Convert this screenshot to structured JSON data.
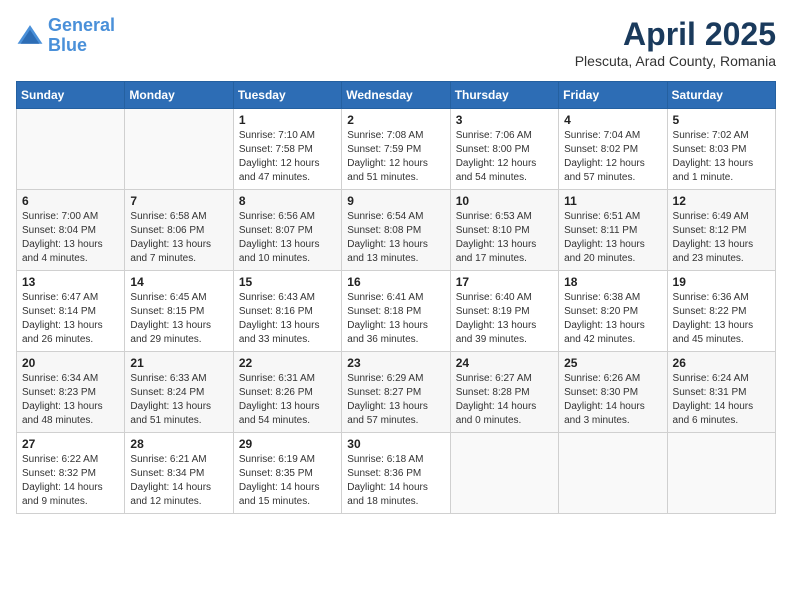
{
  "header": {
    "logo_line1": "General",
    "logo_line2": "Blue",
    "month": "April 2025",
    "location": "Plescuta, Arad County, Romania"
  },
  "weekdays": [
    "Sunday",
    "Monday",
    "Tuesday",
    "Wednesday",
    "Thursday",
    "Friday",
    "Saturday"
  ],
  "weeks": [
    [
      {
        "day": "",
        "info": ""
      },
      {
        "day": "",
        "info": ""
      },
      {
        "day": "1",
        "info": "Sunrise: 7:10 AM\nSunset: 7:58 PM\nDaylight: 12 hours and 47 minutes."
      },
      {
        "day": "2",
        "info": "Sunrise: 7:08 AM\nSunset: 7:59 PM\nDaylight: 12 hours and 51 minutes."
      },
      {
        "day": "3",
        "info": "Sunrise: 7:06 AM\nSunset: 8:00 PM\nDaylight: 12 hours and 54 minutes."
      },
      {
        "day": "4",
        "info": "Sunrise: 7:04 AM\nSunset: 8:02 PM\nDaylight: 12 hours and 57 minutes."
      },
      {
        "day": "5",
        "info": "Sunrise: 7:02 AM\nSunset: 8:03 PM\nDaylight: 13 hours and 1 minute."
      }
    ],
    [
      {
        "day": "6",
        "info": "Sunrise: 7:00 AM\nSunset: 8:04 PM\nDaylight: 13 hours and 4 minutes."
      },
      {
        "day": "7",
        "info": "Sunrise: 6:58 AM\nSunset: 8:06 PM\nDaylight: 13 hours and 7 minutes."
      },
      {
        "day": "8",
        "info": "Sunrise: 6:56 AM\nSunset: 8:07 PM\nDaylight: 13 hours and 10 minutes."
      },
      {
        "day": "9",
        "info": "Sunrise: 6:54 AM\nSunset: 8:08 PM\nDaylight: 13 hours and 13 minutes."
      },
      {
        "day": "10",
        "info": "Sunrise: 6:53 AM\nSunset: 8:10 PM\nDaylight: 13 hours and 17 minutes."
      },
      {
        "day": "11",
        "info": "Sunrise: 6:51 AM\nSunset: 8:11 PM\nDaylight: 13 hours and 20 minutes."
      },
      {
        "day": "12",
        "info": "Sunrise: 6:49 AM\nSunset: 8:12 PM\nDaylight: 13 hours and 23 minutes."
      }
    ],
    [
      {
        "day": "13",
        "info": "Sunrise: 6:47 AM\nSunset: 8:14 PM\nDaylight: 13 hours and 26 minutes."
      },
      {
        "day": "14",
        "info": "Sunrise: 6:45 AM\nSunset: 8:15 PM\nDaylight: 13 hours and 29 minutes."
      },
      {
        "day": "15",
        "info": "Sunrise: 6:43 AM\nSunset: 8:16 PM\nDaylight: 13 hours and 33 minutes."
      },
      {
        "day": "16",
        "info": "Sunrise: 6:41 AM\nSunset: 8:18 PM\nDaylight: 13 hours and 36 minutes."
      },
      {
        "day": "17",
        "info": "Sunrise: 6:40 AM\nSunset: 8:19 PM\nDaylight: 13 hours and 39 minutes."
      },
      {
        "day": "18",
        "info": "Sunrise: 6:38 AM\nSunset: 8:20 PM\nDaylight: 13 hours and 42 minutes."
      },
      {
        "day": "19",
        "info": "Sunrise: 6:36 AM\nSunset: 8:22 PM\nDaylight: 13 hours and 45 minutes."
      }
    ],
    [
      {
        "day": "20",
        "info": "Sunrise: 6:34 AM\nSunset: 8:23 PM\nDaylight: 13 hours and 48 minutes."
      },
      {
        "day": "21",
        "info": "Sunrise: 6:33 AM\nSunset: 8:24 PM\nDaylight: 13 hours and 51 minutes."
      },
      {
        "day": "22",
        "info": "Sunrise: 6:31 AM\nSunset: 8:26 PM\nDaylight: 13 hours and 54 minutes."
      },
      {
        "day": "23",
        "info": "Sunrise: 6:29 AM\nSunset: 8:27 PM\nDaylight: 13 hours and 57 minutes."
      },
      {
        "day": "24",
        "info": "Sunrise: 6:27 AM\nSunset: 8:28 PM\nDaylight: 14 hours and 0 minutes."
      },
      {
        "day": "25",
        "info": "Sunrise: 6:26 AM\nSunset: 8:30 PM\nDaylight: 14 hours and 3 minutes."
      },
      {
        "day": "26",
        "info": "Sunrise: 6:24 AM\nSunset: 8:31 PM\nDaylight: 14 hours and 6 minutes."
      }
    ],
    [
      {
        "day": "27",
        "info": "Sunrise: 6:22 AM\nSunset: 8:32 PM\nDaylight: 14 hours and 9 minutes."
      },
      {
        "day": "28",
        "info": "Sunrise: 6:21 AM\nSunset: 8:34 PM\nDaylight: 14 hours and 12 minutes."
      },
      {
        "day": "29",
        "info": "Sunrise: 6:19 AM\nSunset: 8:35 PM\nDaylight: 14 hours and 15 minutes."
      },
      {
        "day": "30",
        "info": "Sunrise: 6:18 AM\nSunset: 8:36 PM\nDaylight: 14 hours and 18 minutes."
      },
      {
        "day": "",
        "info": ""
      },
      {
        "day": "",
        "info": ""
      },
      {
        "day": "",
        "info": ""
      }
    ]
  ]
}
